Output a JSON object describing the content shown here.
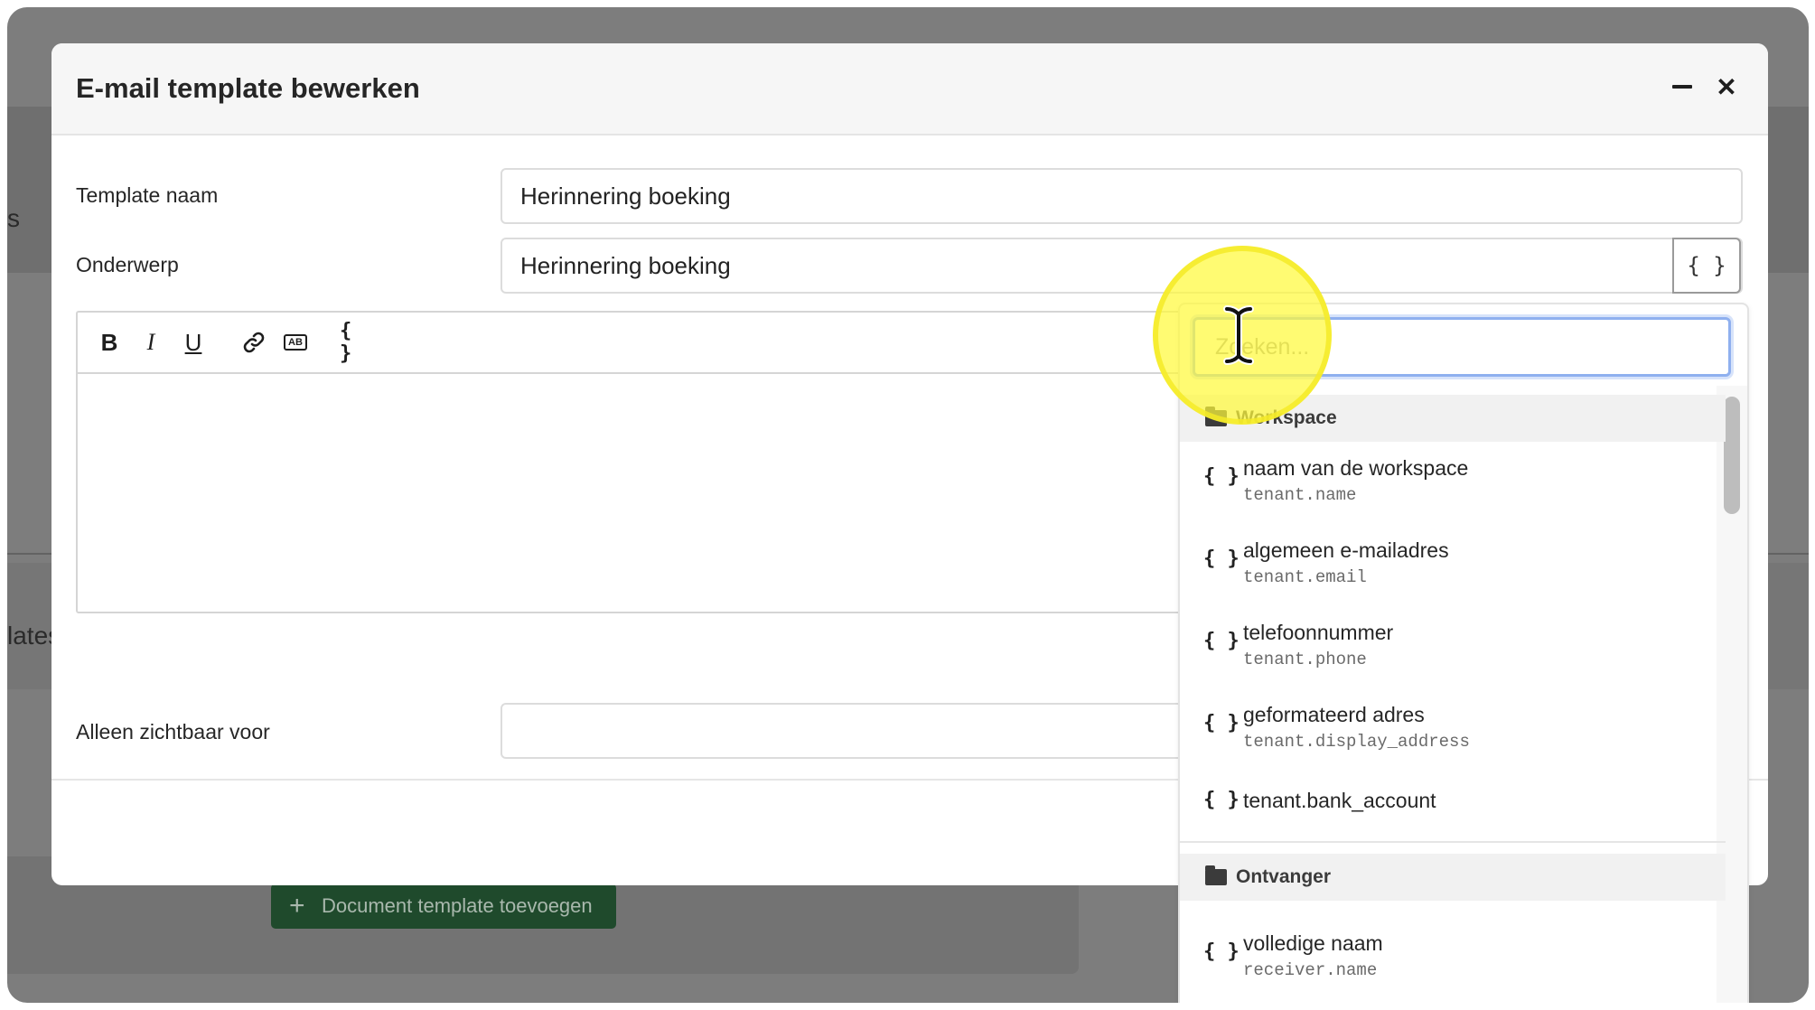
{
  "background": {
    "partial_text_top": "s",
    "partial_text_mid": "lates",
    "add_document_template_label": "Document template toevoegen",
    "plus_symbol": "+"
  },
  "modal": {
    "title": "E-mail template bewerken",
    "minimize_icon": "minimize-icon",
    "close_icon": "close-icon",
    "close_glyph": "✕",
    "fields": {
      "template_name_label": "Template naam",
      "template_name_value": "Herinnering boeking",
      "subject_label": "Onderwerp",
      "subject_value": "Herinnering boeking",
      "variable_button_glyph": "{ }",
      "visible_for_label": "Alleen zichtbaar voor",
      "visible_for_value": ""
    },
    "toolbar": {
      "bold": "B",
      "italic": "I",
      "underline": "U",
      "badge": "AB",
      "variable": "{ }"
    }
  },
  "dropdown": {
    "search_placeholder": "Zoeken...",
    "groups": [
      {
        "name": "Workspace",
        "items": [
          {
            "label": "naam van de workspace",
            "key": "tenant.name"
          },
          {
            "label": "algemeen e-mailadres",
            "key": "tenant.email"
          },
          {
            "label": "telefoonnummer",
            "key": "tenant.phone"
          },
          {
            "label": "geformateerd adres",
            "key": "tenant.display_address"
          },
          {
            "label": "tenant.bank_account",
            "key": ""
          }
        ]
      },
      {
        "name": "Ontvanger",
        "items": [
          {
            "label": "volledige naam",
            "key": "receiver.name"
          }
        ]
      }
    ],
    "item_icon_glyph": "{ }"
  },
  "colors": {
    "overlay": "#7d7d7d",
    "focus_ring": "#8fb0ef",
    "cursor_highlight": "#fffa3c",
    "button_green": "#1f4a2c"
  }
}
